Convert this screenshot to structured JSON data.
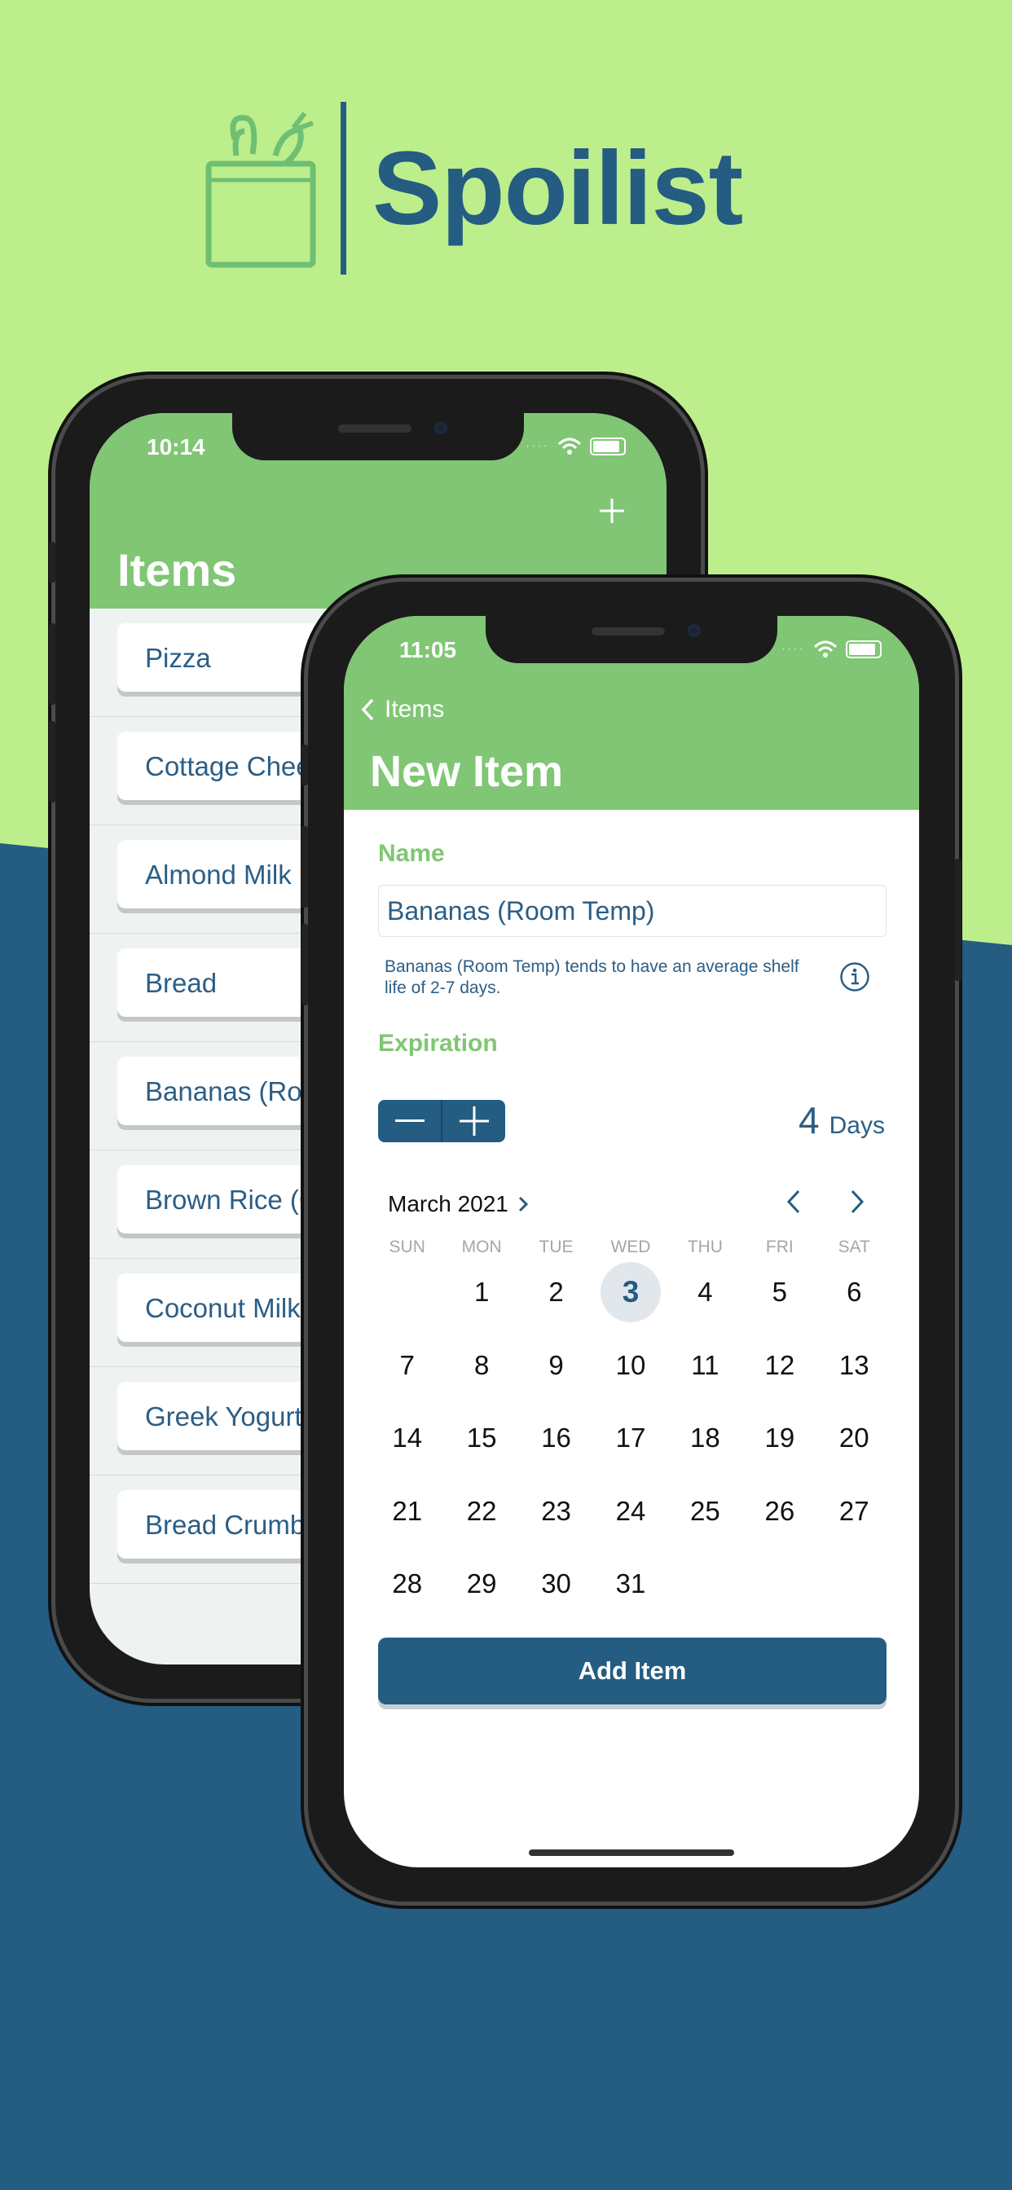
{
  "brand": {
    "name": "Spoilist",
    "green": "#bdee8c",
    "blue": "#245c82",
    "accent_green": "#80c674"
  },
  "back_screen": {
    "status_time": "10:14",
    "add_icon": "plus-icon",
    "title": "Items",
    "items": [
      "Pizza",
      "Cottage Cheese",
      "Almond Milk",
      "Bread",
      "Bananas (Room Temp)",
      "Brown Rice (Cooked)",
      "Coconut Milk",
      "Greek Yogurt",
      "Bread Crumbs"
    ]
  },
  "front_screen": {
    "status_time": "11:05",
    "back_label": "Items",
    "title": "New Item",
    "name_label": "Name",
    "name_value": "Bananas (Room Temp)",
    "hint": "Bananas (Room Temp) tends to have an average shelf life of 2-7 days.",
    "expiration_label": "Expiration",
    "stepper": {
      "minus": "−",
      "plus": "+"
    },
    "days_value": "4",
    "days_unit": "Days",
    "calendar": {
      "month": "March 2021",
      "weekdays": [
        "SUN",
        "MON",
        "TUE",
        "WED",
        "THU",
        "FRI",
        "SAT"
      ],
      "first_weekday_index": 1,
      "num_days": 31,
      "selected_day": 3
    },
    "add_button": "Add Item"
  }
}
